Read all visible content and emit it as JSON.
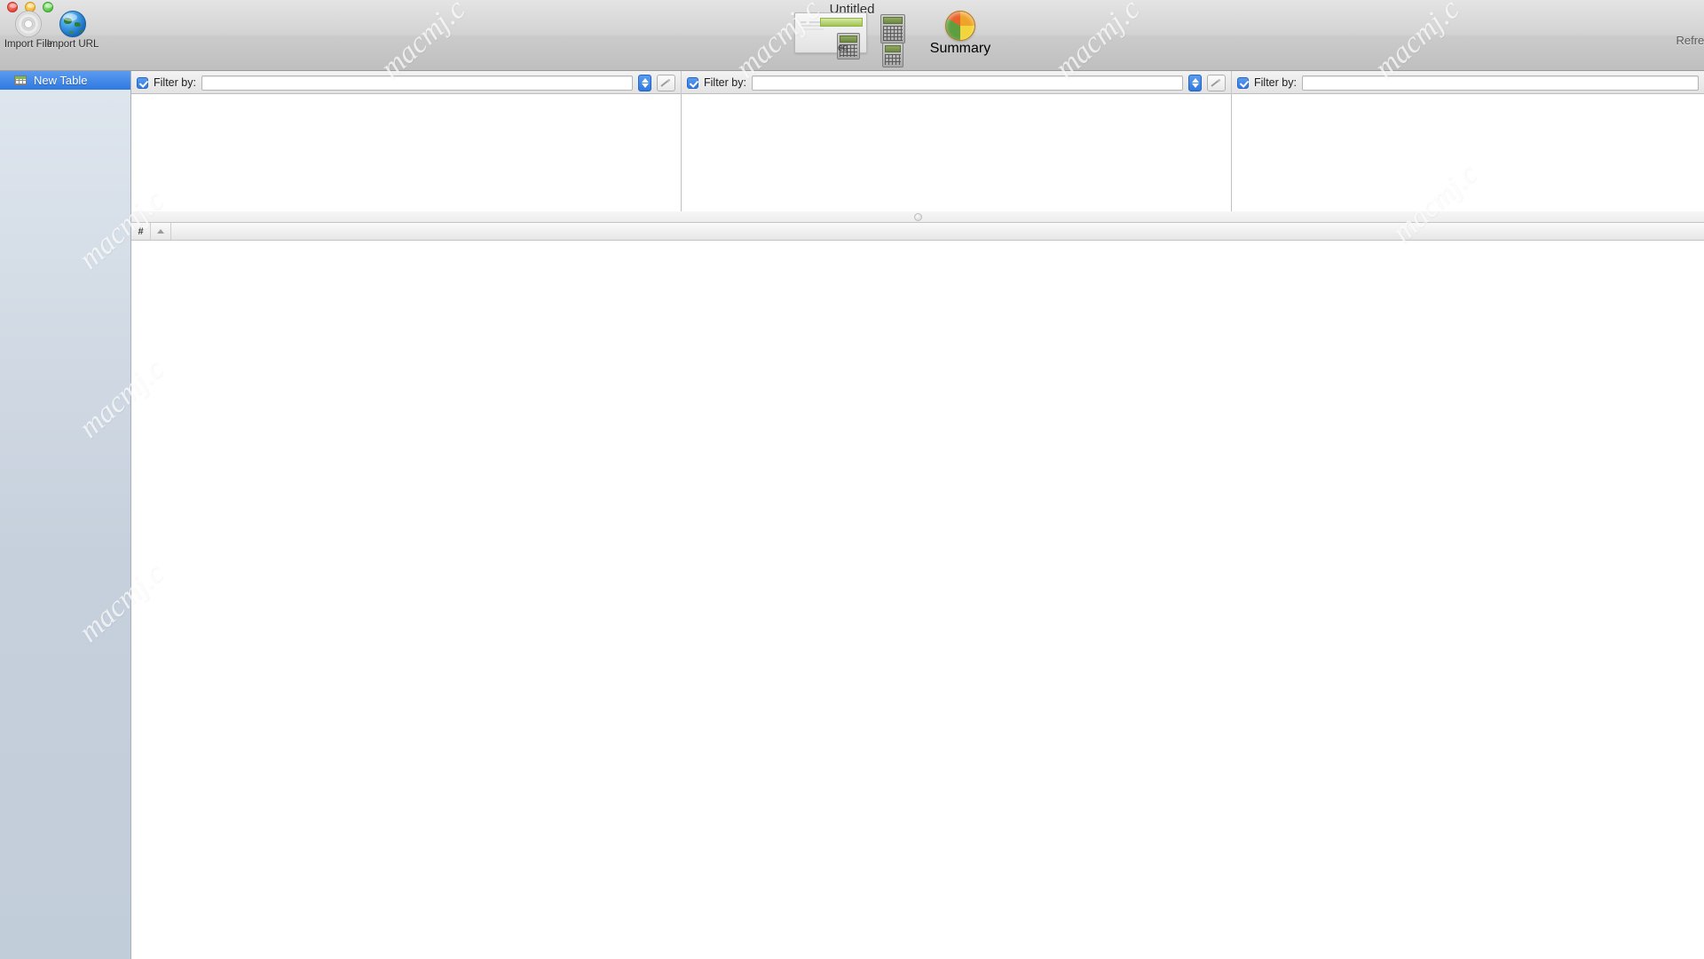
{
  "window": {
    "title": "Untitled",
    "traffic_lights": [
      "close",
      "minimize",
      "zoom"
    ]
  },
  "toolbar": {
    "import_file_label": "Import File",
    "import_file_icon": "disc-icon",
    "import_url_label": "Import URL",
    "import_url_icon": "globe-icon",
    "calculator_group_icon": "calculator-icon",
    "eq_label": "eq",
    "summary_label": "Summary",
    "summary_icon": "pie-chart-icon",
    "refresh_label": "Refresh"
  },
  "sidebar": {
    "items": [
      {
        "label": "New Table",
        "icon": "table-icon",
        "selected": true
      }
    ]
  },
  "filters": [
    {
      "label": "Filter by:",
      "value": "",
      "placeholder": "",
      "checked": true,
      "has_stepper": true,
      "has_wand": true
    },
    {
      "label": "Filter by:",
      "value": "",
      "placeholder": "",
      "checked": true,
      "has_stepper": true,
      "has_wand": true
    },
    {
      "label": "Filter by:",
      "value": "",
      "placeholder": "",
      "checked": true,
      "has_stepper": false,
      "has_wand": false
    }
  ],
  "panels": [
    {
      "name": "panel-left",
      "rows": []
    },
    {
      "name": "panel-middle",
      "rows": []
    },
    {
      "name": "panel-right",
      "rows": []
    }
  ],
  "results": {
    "columns": [
      {
        "label": "#"
      },
      {
        "label": "",
        "sort_icon": "sort-ascending-icon"
      },
      {
        "label": ""
      }
    ],
    "rows": []
  },
  "colors": {
    "selection_blue": "#2f79e0",
    "sidebar_bg": "#c6d0dc",
    "toolbar_bg": "#d3d3d3",
    "panel_bg": "#ffffff"
  },
  "watermark": {
    "text": "macmj.c"
  }
}
